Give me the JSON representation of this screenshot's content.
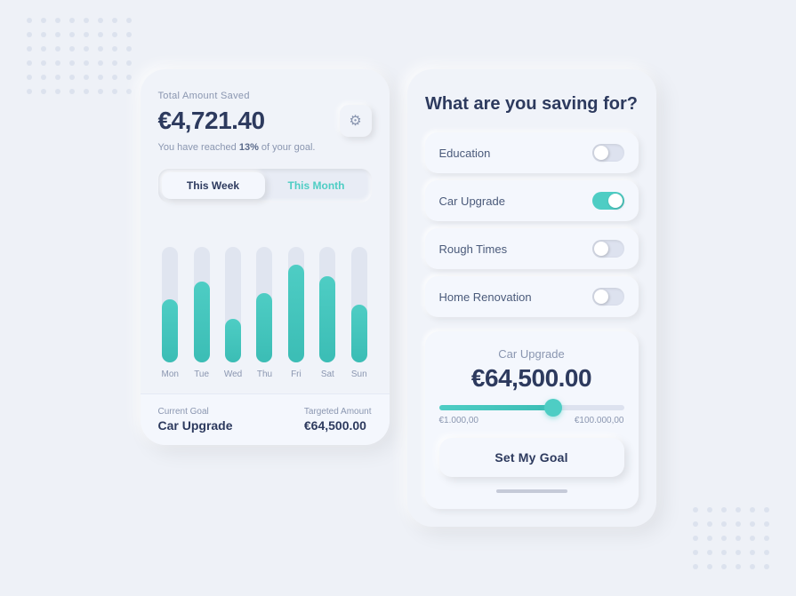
{
  "left": {
    "total_label": "Total Amount Saved",
    "amount": "€4,721.40",
    "goal_text_pre": "You have reached ",
    "goal_pct": "13%",
    "goal_text_post": " of your goal.",
    "tab_week": "This Week",
    "tab_month": "This Month",
    "bars": [
      {
        "day": "Mon",
        "height_pct": 55
      },
      {
        "day": "Tue",
        "height_pct": 70
      },
      {
        "day": "Wed",
        "height_pct": 38
      },
      {
        "day": "Thu",
        "height_pct": 60
      },
      {
        "day": "Fri",
        "height_pct": 85
      },
      {
        "day": "Sat",
        "height_pct": 75
      },
      {
        "day": "Sun",
        "height_pct": 50
      }
    ],
    "current_goal_label": "Current Goal",
    "current_goal_val": "Car Upgrade",
    "targeted_label": "Targeted Amount",
    "targeted_val": "€64,500.00"
  },
  "right": {
    "title": "What are you saving for?",
    "items": [
      {
        "label": "Education",
        "on": false
      },
      {
        "label": "Car Upgrade",
        "on": true
      },
      {
        "label": "Rough Times",
        "on": false
      },
      {
        "label": "Home Renovation",
        "on": false
      }
    ],
    "goal_card": {
      "title": "Car Upgrade",
      "amount": "€64,500.00",
      "slider_min": "€1.000,00",
      "slider_max": "€100.000,00",
      "slider_pct": 62
    },
    "set_goal_btn": "Set My Goal"
  },
  "gear_icon": "⚙"
}
